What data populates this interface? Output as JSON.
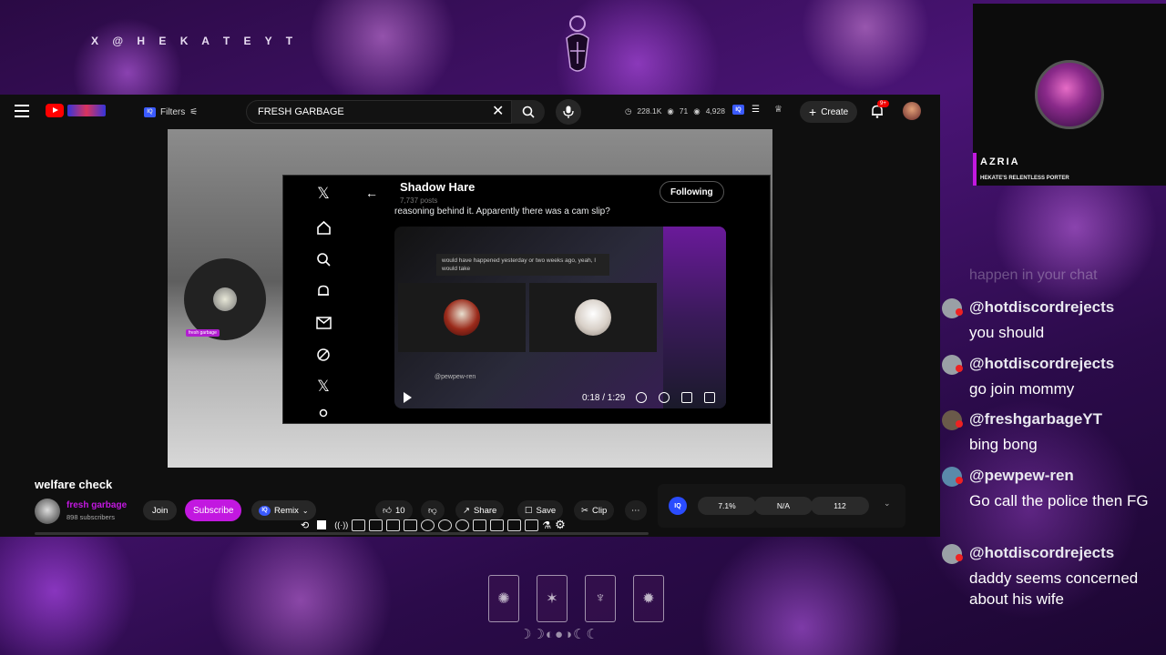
{
  "overlay": {
    "handle": "X @ H E K A T E Y T",
    "streamer_name": "AZRIA",
    "streamer_subtitle": "HEKATE'S RELENTLESS PORTER",
    "moon_phases": "☽☽◐●◑☾☾"
  },
  "youtube": {
    "filters_label": "Filters",
    "iq_badge": "IQ",
    "search_value": "FRESH GARBAGE",
    "stats": {
      "views": "228.1K",
      "watching": "71",
      "likes": "4,928"
    },
    "create_label": "Create",
    "notification_badge": "9+",
    "video_title": "welfare check",
    "channel_name": "fresh garbage",
    "channel_subs": "898 subscribers",
    "join_label": "Join",
    "subscribe_label": "Subscribe",
    "remix_label": "Remix",
    "like_count": "10",
    "share_label": "Share",
    "save_label": "Save",
    "clip_label": "Clip",
    "iq_stats": [
      "7.1%",
      "N/A",
      "112"
    ],
    "video_circle_tag": "fresh garbage"
  },
  "x_post": {
    "profile_name": "Shadow Hare",
    "post_count": "7,737 posts",
    "following_label": "Following",
    "tweet_text": "reasoning behind it. Apparently there was a cam slip?",
    "media_quote": "would have happened yesterday or two weeks ago, yeah, I would take",
    "media_handle": "@pewpew-ren",
    "media_time": "0:18 / 1:29"
  },
  "chat": {
    "ghost_text": "happen in your chat",
    "messages": [
      {
        "user": "@hotdiscordrejects",
        "text": "you should"
      },
      {
        "user": "@hotdiscordrejects",
        "text": "go join mommy"
      },
      {
        "user": "@freshgarbageYT",
        "text": "bing bong"
      },
      {
        "user": "@pewpew-ren",
        "text": "Go call the police then FG"
      },
      {
        "user": "@hotdiscordrejects",
        "text": "daddy seems concerned about his wife"
      }
    ]
  },
  "colors": {
    "accent": "#c218e0",
    "youtube_red": "#ff0000",
    "iq_blue": "#2a4cff"
  }
}
